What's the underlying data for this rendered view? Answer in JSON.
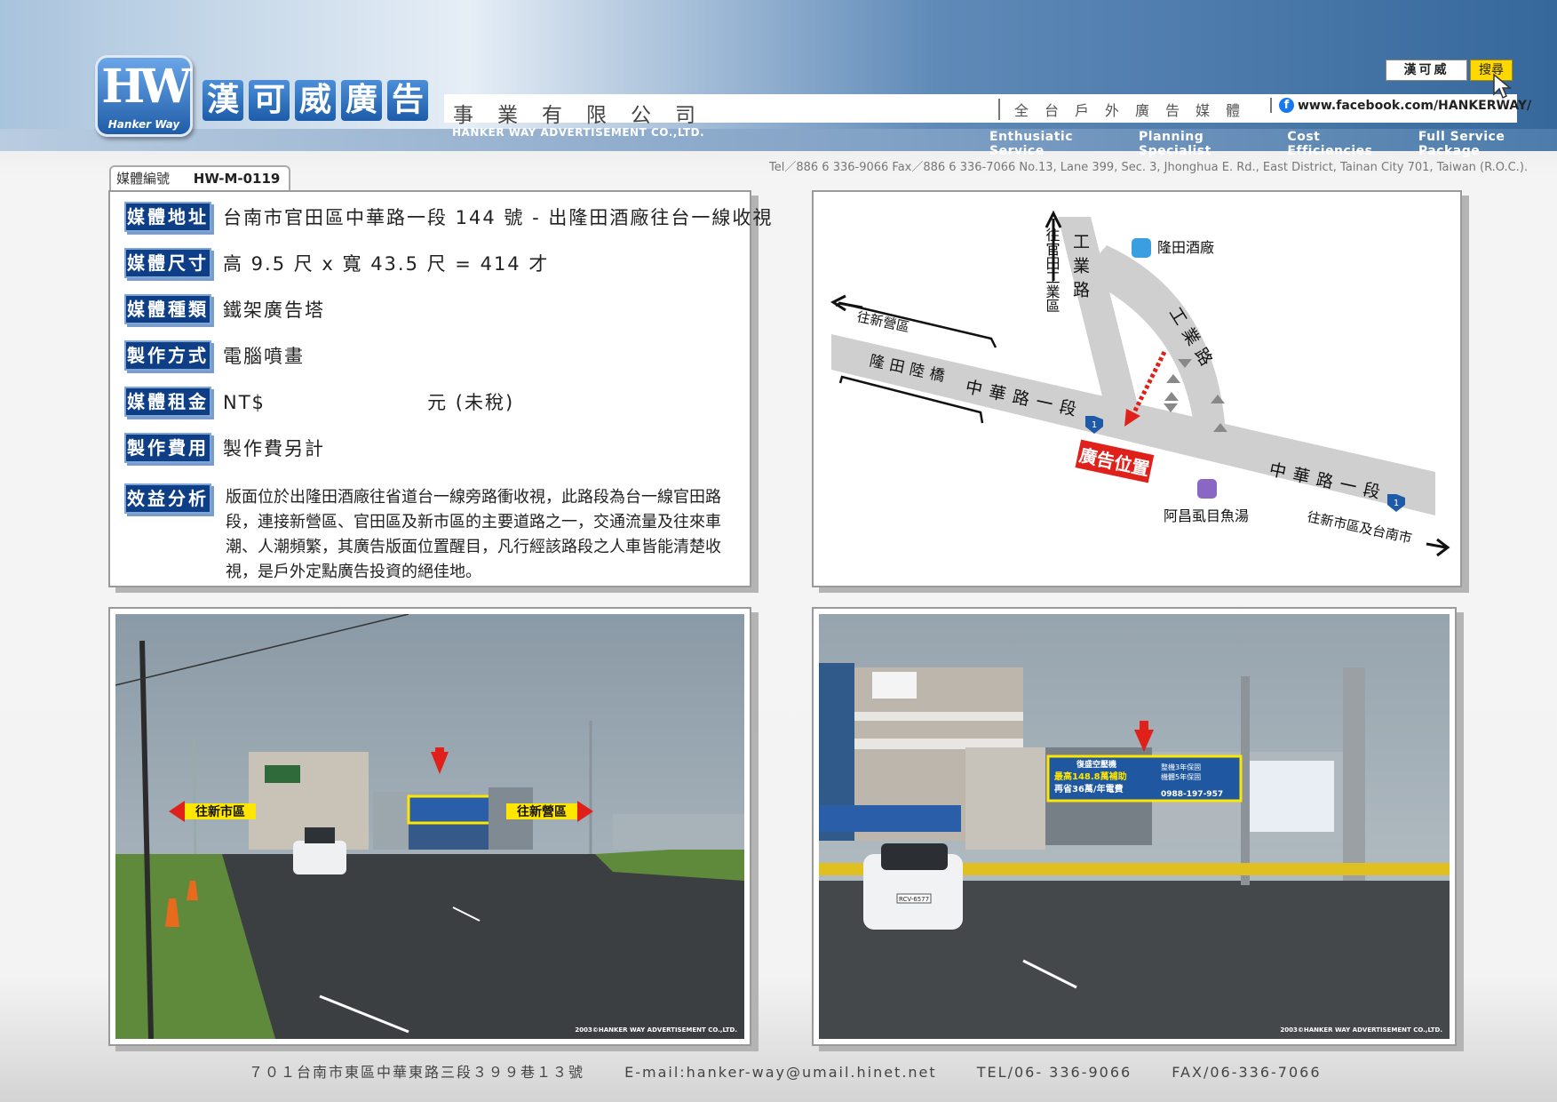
{
  "header": {
    "logo_text": "HW",
    "logo_sub": "Hanker Way",
    "brand_chars": [
      "漢",
      "可",
      "威",
      "廣",
      "告"
    ],
    "company_zh": "事業有限公司",
    "company_en": "HANKER WAY ADVERTISEMENT CO.,LTD.",
    "tagline": "全台戶外廣告媒體",
    "facebook": "www.facebook.com/HANKERWAY/",
    "search_value": "漢可威",
    "search_button": "搜尋",
    "services": [
      "Enthusiatic Service",
      "Planning Specialist",
      "Cost Efficiencies",
      "Full Service Package"
    ],
    "contact": "Tel／886 6 336-9066   Fax／886 6 336-7066   No.13, Lane 399, Sec. 3, Jhonghua E. Rd., East District, Tainan City 701, Taiwan (R.O.C.)."
  },
  "media": {
    "number_label": "媒體編號",
    "number_value": "HW-M-0119",
    "rows": [
      {
        "label": "媒體地址",
        "value": "台南市官田區中華路一段 144 號 - 出隆田酒廠往台一線收視"
      },
      {
        "label": "媒體尺寸",
        "value": "高 9.5 尺 x 寬 43.5 尺 = 414 才"
      },
      {
        "label": "媒體種類",
        "value": "鐵架廣告塔"
      },
      {
        "label": "製作方式",
        "value": "電腦噴畫"
      },
      {
        "label": "媒體租金",
        "value": "NT$                     元 (未稅)"
      },
      {
        "label": "製作費用",
        "value": "製作費另計"
      }
    ],
    "analysis_label": "效益分析",
    "analysis_text": "版面位於出隆田酒廠往省道台一線旁路衝收視，此路段為台一線官田路段，連接新營區、官田區及新市區的主要道路之一，交通流量及往來車潮、人潮頻繁，其廣告版面位置醒目，凡行經該路段之人車皆能清楚收視，是戶外定點廣告投資的絕佳地。"
  },
  "map": {
    "to_industrial": "往官田工業區",
    "gongye_road_1": "工業路",
    "gongye_road_2": "工業路",
    "longtian_winery": "隆田酒廠",
    "to_xinying": "往新營區",
    "longtian_bridge": "隆田陸橋",
    "zhonghua_1": "中華路一段",
    "zhonghua_2": "中華路一段",
    "route_badge": "1",
    "ad_position": "廣告位置",
    "fish_soup": "阿昌虱目魚湯",
    "to_xinshi": "往新市區及台南市"
  },
  "photos": {
    "left_sign_left": "往新市區",
    "left_sign_right": "往新營區",
    "billboard_brand": "復盛空壓機",
    "billboard_line1": "最高148.8萬補助",
    "billboard_line2": "再省36萬/年電費",
    "billboard_right1": "整機3年保固",
    "billboard_right2": "機體5年保固",
    "billboard_phone": "0988-197-957",
    "plate": "RCV-6577",
    "copyright": "2003©HANKER WAY ADVERTISEMENT CO.,LTD."
  },
  "footer": {
    "address": "７０１台南市東區中華東路三段３９９巷１３號",
    "email": "E-mail:hanker-way@umail.hinet.net",
    "tel": "TEL/06- 336-9066",
    "fax": "FAX/06-336-7066"
  },
  "colors": {
    "accent_blue": "#0e3f86",
    "ad_red": "#e0201b",
    "sign_yellow": "#ffe600"
  }
}
